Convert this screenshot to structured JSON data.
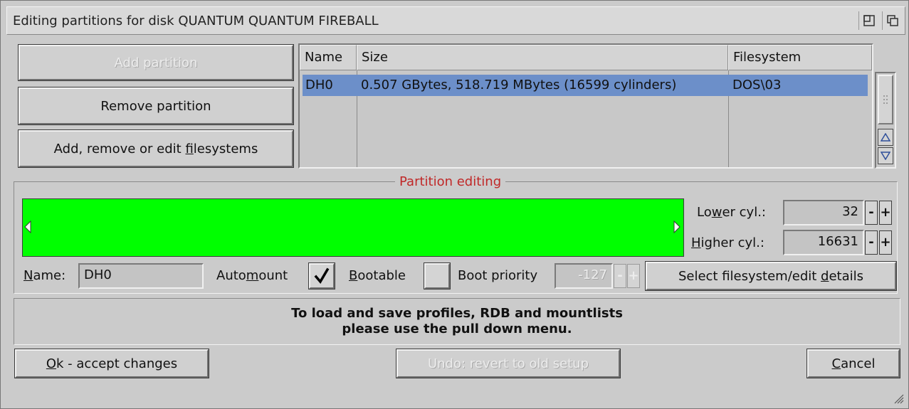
{
  "window": {
    "title": "Editing partitions for disk QUANTUM QUANTUM FIREBALL",
    "icons": [
      "iconify-icon",
      "depth-icon"
    ]
  },
  "left_buttons": {
    "add_partition": "Add partition",
    "remove_partition": "Remove partition",
    "edit_filesystems_pre": "Add, remove or edit ",
    "edit_filesystems_key": "f",
    "edit_filesystems_post": "ilesystems"
  },
  "partition_list": {
    "columns": [
      "Name",
      "Size",
      "Filesystem"
    ],
    "rows": [
      {
        "name": "DH0",
        "size": "0.507 GBytes, 518.719 MBytes (16599 cylinders)",
        "filesystem": "DOS\\03",
        "selected": true
      }
    ]
  },
  "partition_editing": {
    "title": "Partition editing",
    "bar_color": "#00ff00",
    "lower_cyl_pre": "Lo",
    "lower_cyl_key": "w",
    "lower_cyl_post": "er cyl.:",
    "lower_cyl_value": "32",
    "higher_cyl_key": "H",
    "higher_cyl_post": "igher cyl.:",
    "higher_cyl_value": "16631",
    "minus": "-",
    "plus": "+",
    "name_key": "N",
    "name_post": "ame:",
    "name_value": "DH0",
    "automount_pre": "Auto",
    "automount_key": "m",
    "automount_post": "ount",
    "automount_checked": true,
    "bootable_key": "B",
    "bootable_post": "ootable",
    "bootable_checked": false,
    "boot_priority_label": "Boot priority",
    "boot_priority_value": "-127",
    "select_fs_pre": "Select filesystem/edit ",
    "select_fs_key": "d",
    "select_fs_post": "etails"
  },
  "info": {
    "line1": "To load and save profiles, RDB and mountlists",
    "line2": "please use the pull down menu."
  },
  "bottom_buttons": {
    "ok_key": "O",
    "ok_post": "k - accept changes",
    "undo": "Undo: revert to old setup",
    "cancel_key": "C",
    "cancel_post": "ancel"
  },
  "colors": {
    "window_bg": "#cbcbcb",
    "selection": "#6c8fc9",
    "group_title": "#c02828"
  }
}
